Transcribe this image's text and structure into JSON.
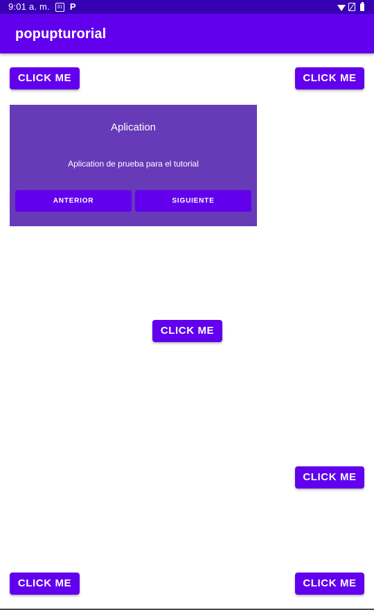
{
  "status_bar": {
    "time": "9:01 a. m.",
    "notification_icon": "calendar-notification-icon",
    "app_icon": "p-icon",
    "app_icon_glyph": "P",
    "right_icons": [
      "wifi-icon",
      "no-sim-icon",
      "battery-icon"
    ]
  },
  "app_bar": {
    "title": "popupturorial"
  },
  "buttons": {
    "top_left": "CLICK ME",
    "top_right": "CLICK ME",
    "center": "CLICK ME",
    "lower_right": "CLICK ME",
    "bottom_left": "CLICK ME",
    "bottom_right": "CLICK ME"
  },
  "popup": {
    "title": "Aplication",
    "message": "Aplication de prueba para el tutorial",
    "previous_label": "ANTERIOR",
    "next_label": "SIGUIENTE"
  },
  "colors": {
    "status_bar": "#3700b3",
    "primary": "#6200ee",
    "popup_background": "#673ab7",
    "background": "#ffffff"
  }
}
